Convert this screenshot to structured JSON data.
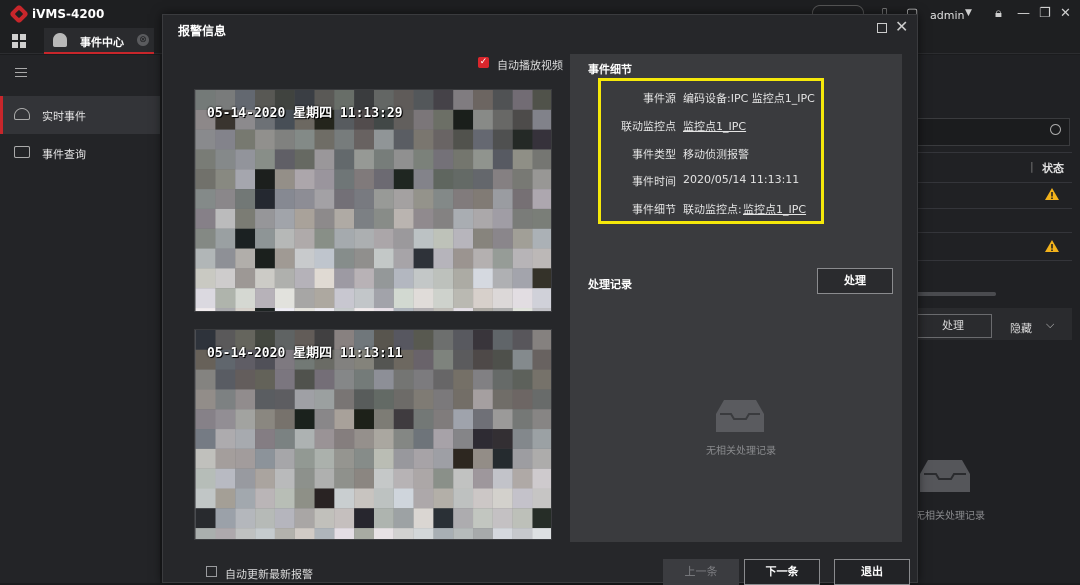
{
  "app": {
    "title": "iVMS-4200",
    "user": "admin"
  },
  "tabs": [
    {
      "label": "事件中心",
      "close": "⊗"
    }
  ],
  "sidebar": {
    "items": [
      {
        "label": "实时事件",
        "icon": "alarm-bell-icon",
        "active": true
      },
      {
        "label": "事件查询",
        "icon": "event-search-icon",
        "active": false
      }
    ]
  },
  "background_panel": {
    "status_header": "状态",
    "handle_label": "处理",
    "hide_label": "隐藏",
    "empty_text": "无相关处理记录",
    "warning_color": "#f2b21b"
  },
  "modal": {
    "title": "报警信息",
    "autoplay_label": "自动播放视频",
    "autoplay_checked": true,
    "videos": [
      {
        "osd": "05-14-2020 星期四 11:13:29"
      },
      {
        "osd": "05-14-2020 星期四 11:13:11"
      }
    ],
    "details": {
      "header": "事件细节",
      "rows": [
        {
          "key": "事件源",
          "value": "编码设备:IPC 监控点1_IPC",
          "link": false
        },
        {
          "key": "联动监控点",
          "value": "监控点1_IPC",
          "link": true
        },
        {
          "key": "事件类型",
          "value": "移动侦测报警",
          "link": false
        },
        {
          "key": "事件时间",
          "value": "2020/05/14 11:13:11",
          "link": false
        },
        {
          "key": "事件细节",
          "value_prefix": "联动监控点:",
          "value": "监控点1_IPC",
          "link": true
        }
      ],
      "highlight_color": "#f5e80a"
    },
    "records": {
      "label": "处理记录",
      "handle_button": "处理",
      "empty_text": "无相关处理记录"
    },
    "footer": {
      "auto_update_label": "自动更新最新报警",
      "prev_button": "上一条",
      "next_button": "下一条",
      "exit_button": "退出"
    }
  },
  "colors": {
    "accent": "#c8262b",
    "checkbox": "#d9262c"
  }
}
